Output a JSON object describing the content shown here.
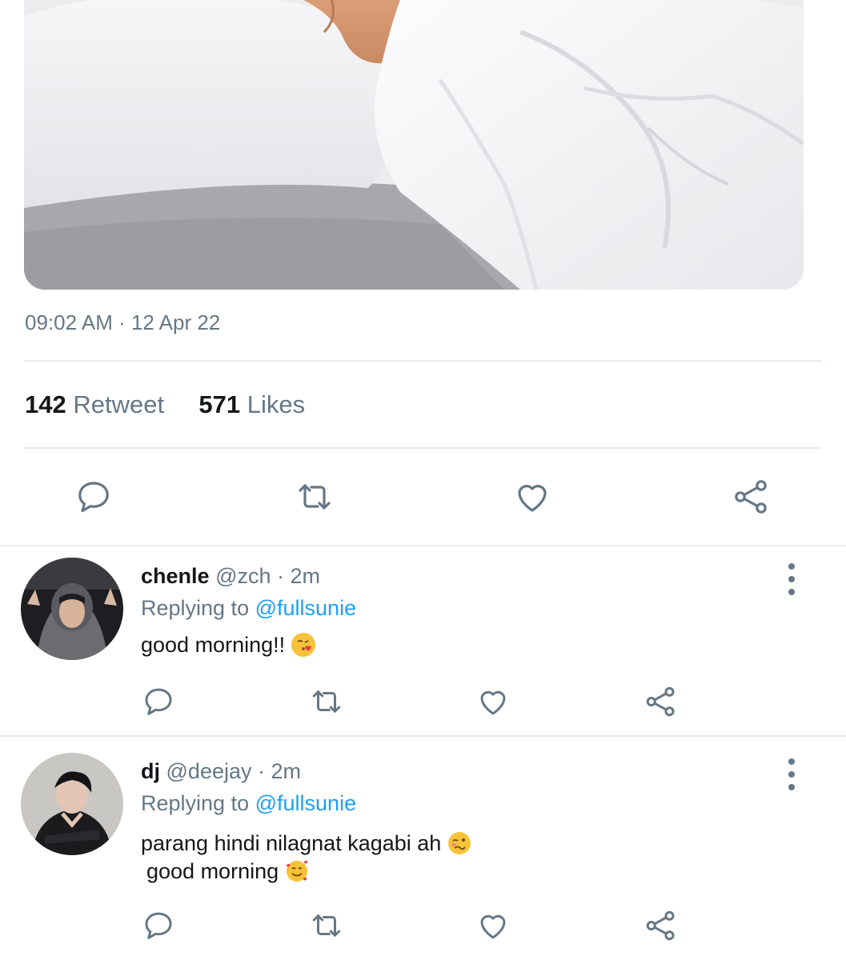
{
  "tweet": {
    "timestamp": "09:02 AM · 12 Apr 22",
    "retweet_count": "142",
    "retweet_label": "Retweet",
    "likes_count": "571",
    "likes_label": "Likes"
  },
  "actions": [
    "reply-icon",
    "retweet-icon",
    "like-icon",
    "share-icon"
  ],
  "replies": [
    {
      "name": "chenle",
      "handle": "@zch",
      "separator": "·",
      "age": "2m",
      "replying_prefix": "Replying to",
      "replying_mention": "@fullsunie",
      "text_line1": "good morning!!",
      "emoji1": "kiss-emoji"
    },
    {
      "name": "dj",
      "handle": "@deejay",
      "separator": "·",
      "age": "2m",
      "replying_prefix": "Replying to",
      "replying_mention": "@fullsunie",
      "text_line1": "parang hindi nilagnat kagabi ah",
      "text_line2": "good morning",
      "emoji1": "woozy-emoji",
      "emoji2": "smiling-hearts-emoji"
    }
  ],
  "colors": {
    "muted": "#657786",
    "link": "#1da1f2",
    "divider": "#e6ecf0",
    "text": "#14171a"
  }
}
